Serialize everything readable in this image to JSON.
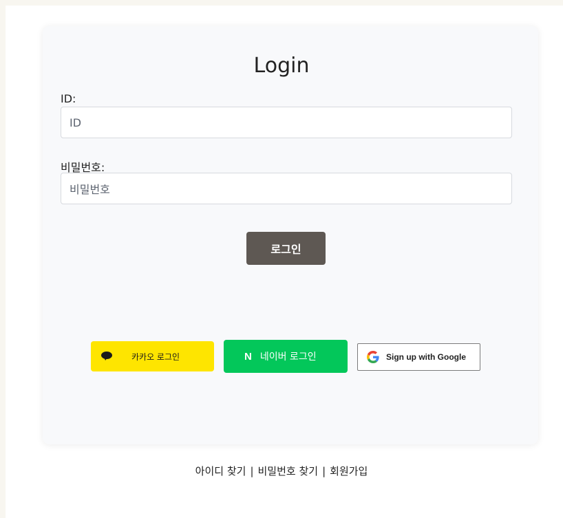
{
  "login_form": {
    "title": "Login",
    "id_label": "ID:",
    "id_placeholder": "ID",
    "password_label": "비밀번호:",
    "password_placeholder": "비밀번호",
    "submit_label": "로그인"
  },
  "social_logins": {
    "kakao_label": "카카오 로그인",
    "naver_label": "네이버 로그인",
    "naver_mark": "N",
    "google_label": "Sign up with Google",
    "colors": {
      "kakao": "#fee500",
      "naver": "#03c75a",
      "login_button": "#5e5853"
    }
  },
  "footer_links": {
    "find_id": "아이디 찾기",
    "find_password": "비밀번호 찾기",
    "signup": "회원가입",
    "separator": "|"
  }
}
